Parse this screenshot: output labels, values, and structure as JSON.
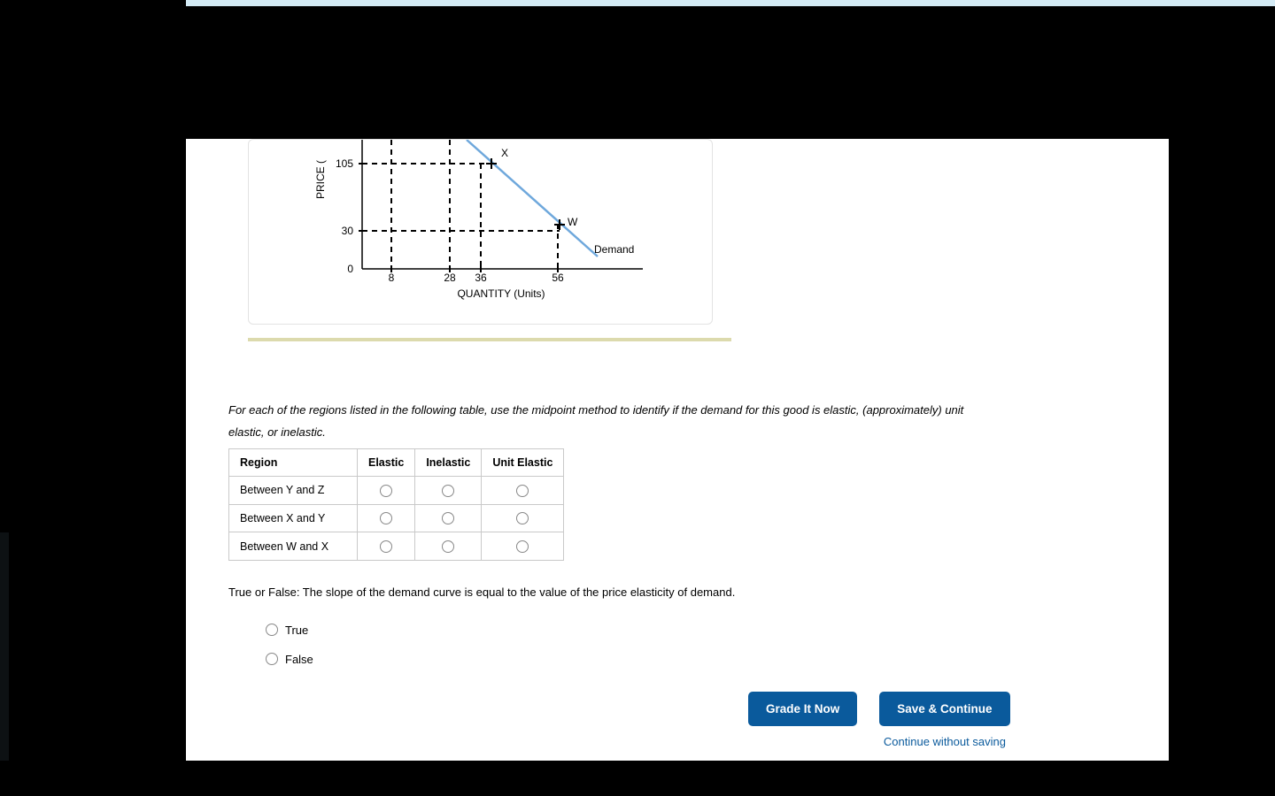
{
  "chart_data": {
    "type": "line",
    "title": "",
    "xlabel": "QUANTITY (Units)",
    "ylabel": "PRICE (",
    "line_label": "Demand",
    "x_ticks": [
      0,
      8,
      28,
      36,
      56
    ],
    "y_ticks": [
      30,
      105
    ],
    "points": [
      {
        "label": "X",
        "x": 36,
        "y": 105
      },
      {
        "label": "W",
        "x": 56,
        "y": 30
      }
    ],
    "guide_lines": {
      "horizontal_at_y": [
        105,
        30
      ],
      "vertical_at_x": [
        8,
        28,
        36,
        56
      ]
    },
    "xlim": [
      0,
      80
    ],
    "ylim": [
      0,
      240
    ]
  },
  "question": {
    "prompt": "For each of the regions listed in the following table, use the midpoint method to identify if the demand for this good is elastic, (approximately) unit elastic, or inelastic."
  },
  "table": {
    "headers": [
      "Region",
      "Elastic",
      "Inelastic",
      "Unit Elastic"
    ],
    "rows": [
      {
        "region": "Between Y and Z"
      },
      {
        "region": "Between X and Y"
      },
      {
        "region": "Between W and X"
      }
    ]
  },
  "tf": {
    "prompt": "True or False: The slope of the demand curve is equal to the value of the price elasticity of demand.",
    "options": [
      "True",
      "False"
    ]
  },
  "buttons": {
    "grade": "Grade It Now",
    "save": "Save & Continue",
    "skip": "Continue without saving"
  }
}
